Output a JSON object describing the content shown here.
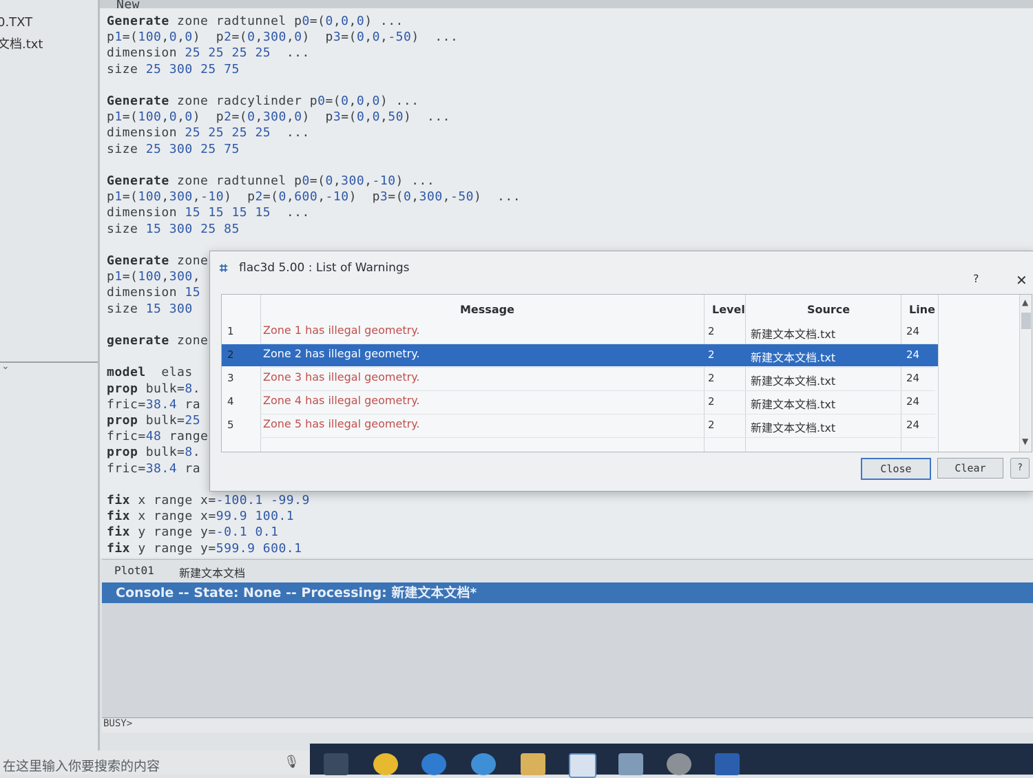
{
  "left_pane": {
    "files": [
      "0.TXT",
      "文档.txt"
    ]
  },
  "editor": {
    "top_label": "New",
    "blocks": [
      {
        "lines": [
          "Generate zone radtunnel p0=(0,0,0) ...",
          "p1=(100,0,0)  p2=(0,300,0)  p3=(0,0,-50)  ...",
          "dimension 25 25 25 25  ...",
          "size 25 300 25 75"
        ]
      },
      {
        "lines": [
          "Generate zone radcylinder p0=(0,0,0) ...",
          "p1=(100,0,0)  p2=(0,300,0)  p3=(0,0,50)  ...",
          "dimension 25 25 25 25  ...",
          "size 25 300 25 75"
        ]
      },
      {
        "lines": [
          "Generate zone radtunnel p0=(0,300,-10) ...",
          "p1=(100,300,-10)  p2=(0,600,-10)  p3=(0,300,-50)  ...",
          "dimension 15 15 15 15  ...",
          "size 15 300 25 85"
        ]
      },
      {
        "lines": [
          "Generate zone",
          "p1=(100,300,",
          "dimension 15",
          "size 15 300"
        ]
      },
      {
        "lines": [
          "generate zone"
        ]
      },
      {
        "lines": [
          "model  elas",
          "prop bulk=8.",
          "fric=38.4 ra",
          "prop bulk=25",
          "fric=48 range",
          "prop bulk=8.",
          "fric=38.4 ra"
        ]
      },
      {
        "lines": [
          "fix x range x=-100.1 -99.9",
          "fix x range x=99.9 100.1",
          "fix y range y=-0.1 0.1",
          "fix y range y=599.9 600.1"
        ]
      }
    ]
  },
  "tabs": [
    "Plot01",
    "新建文本文档"
  ],
  "console": {
    "header": "Console -- State: None -- Processing: 新建文本文档*",
    "prompt": "BUSY>"
  },
  "dialog": {
    "title": "flac3d 5.00 : List of Warnings",
    "help": "?",
    "close_glyph": "✕",
    "columns": [
      "Message",
      "Level",
      "Source",
      "Line"
    ],
    "rows": [
      {
        "index": "1",
        "message": "Zone 1 has illegal geometry.",
        "level": "2",
        "source": "新建文本文档.txt",
        "line": "24"
      },
      {
        "index": "2",
        "message": "Zone 2 has illegal geometry.",
        "level": "2",
        "source": "新建文本文档.txt",
        "line": "24"
      },
      {
        "index": "3",
        "message": "Zone 3 has illegal geometry.",
        "level": "2",
        "source": "新建文本文档.txt",
        "line": "24"
      },
      {
        "index": "4",
        "message": "Zone 4 has illegal geometry.",
        "level": "2",
        "source": "新建文本文档.txt",
        "line": "24"
      },
      {
        "index": "5",
        "message": "Zone 5 has illegal geometry.",
        "level": "2",
        "source": "新建文本文档.txt",
        "line": "24"
      }
    ],
    "selected_row": "2",
    "buttons": {
      "close": "Close",
      "clear": "Clear",
      "help": "?"
    }
  },
  "taskbar": {
    "search_placeholder": "在这里输入你要搜索的内容",
    "icons": [
      "task-view-icon",
      "file-manager-icon",
      "edge-icon",
      "browser-icon",
      "folder-icon",
      "flac3d-icon",
      "app-icon",
      "user-icon",
      "word-icon"
    ]
  },
  "colors": {
    "console_header": "#3a73b6",
    "selected_row": "#2f6cc0",
    "warning_text": "#c0504d",
    "taskbar": "#1e2d44"
  }
}
